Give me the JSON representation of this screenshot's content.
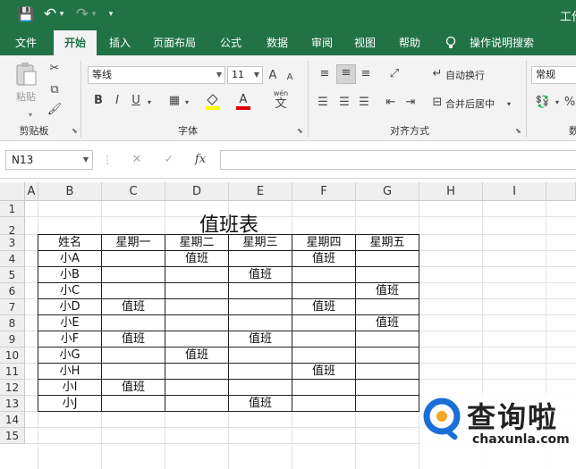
{
  "window": {
    "title_fragment": "工作",
    "quick_access": {
      "save": "💾",
      "undo": "↶",
      "undo_drop": "▾",
      "redo": "↷",
      "redo_drop": "▾",
      "customize": "▾"
    }
  },
  "menu": {
    "tabs": [
      "文件",
      "开始",
      "插入",
      "页面布局",
      "公式",
      "数据",
      "审阅",
      "视图",
      "帮助"
    ],
    "active_tab": "开始",
    "tell_me_icon": "lightbulb-icon",
    "tell_me": "操作说明搜索"
  },
  "ribbon": {
    "clipboard": {
      "paste": "粘贴",
      "label": "剪贴板"
    },
    "font": {
      "name": "等线",
      "size": "11",
      "grow": "A",
      "shrink": "A",
      "bold": "B",
      "italic": "I",
      "underline": "U",
      "phonetic_top": "wén",
      "phonetic": "文",
      "label": "字体"
    },
    "alignment": {
      "wrap_text": "自动换行",
      "merge_center": "合并后居中",
      "label": "对齐方式"
    },
    "number": {
      "format": "常规",
      "percent": "%",
      "label_fragment": "数"
    }
  },
  "formula_bar": {
    "name_box": "N13",
    "cancel": "✕",
    "enter": "✓",
    "fx": "fx",
    "formula": ""
  },
  "sheet": {
    "columns": [
      "A",
      "B",
      "C",
      "D",
      "E",
      "F",
      "G",
      "H",
      "I"
    ],
    "rows": [
      "1",
      "2",
      "3",
      "4",
      "5",
      "6",
      "7",
      "8",
      "9",
      "10",
      "11",
      "12",
      "13",
      "14",
      "15"
    ],
    "title": "值班表",
    "header": [
      "姓名",
      "星期一",
      "星期二",
      "星期三",
      "星期四",
      "星期五"
    ],
    "data": [
      [
        "小A",
        "",
        "值班",
        "",
        "值班",
        ""
      ],
      [
        "小B",
        "",
        "",
        "值班",
        "",
        ""
      ],
      [
        "小C",
        "",
        "",
        "",
        "",
        "值班"
      ],
      [
        "小D",
        "值班",
        "",
        "",
        "值班",
        ""
      ],
      [
        "小E",
        "",
        "",
        "",
        "",
        "值班"
      ],
      [
        "小F",
        "值班",
        "",
        "值班",
        "",
        ""
      ],
      [
        "小G",
        "",
        "值班",
        "",
        "",
        ""
      ],
      [
        "小H",
        "",
        "",
        "",
        "值班",
        ""
      ],
      [
        "小I",
        "值班",
        "",
        "",
        "",
        ""
      ],
      [
        "小J",
        "",
        "",
        "值班",
        "",
        ""
      ]
    ]
  },
  "watermark": {
    "brand": "查询啦",
    "domain": "chaxunla.com",
    "accent": "#1a6fd6",
    "dot": "#f5a623"
  }
}
